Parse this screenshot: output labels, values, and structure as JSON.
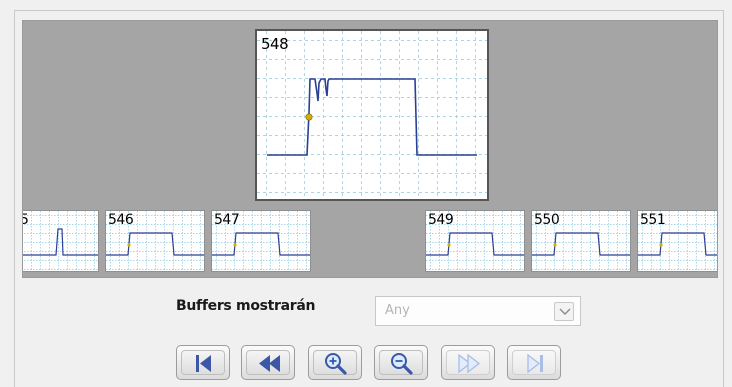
{
  "filmstrip": {
    "selected": "548",
    "thumbnails": [
      {
        "label": "5"
      },
      {
        "label": "546"
      },
      {
        "label": "547"
      },
      {
        "label": "548"
      },
      {
        "label": "549"
      },
      {
        "label": "550"
      },
      {
        "label": "551"
      }
    ]
  },
  "controls": {
    "buffers_label": "Buffers mostrarán",
    "buffers_value": "Any"
  },
  "nav_buttons": [
    {
      "icon": "skip-to-first-icon",
      "enabled": true
    },
    {
      "icon": "rewind-icon",
      "enabled": true
    },
    {
      "icon": "zoom-in-icon",
      "enabled": true
    },
    {
      "icon": "zoom-out-icon",
      "enabled": true
    },
    {
      "icon": "fast-forward-icon",
      "enabled": false
    },
    {
      "icon": "skip-to-last-icon",
      "enabled": false
    }
  ],
  "colors": {
    "waveform": "#2b3f94",
    "grid": "#8ec7de",
    "cursor": "#d4b000",
    "enabled_icon": "#3b57a6",
    "disabled_icon": "#a9bde6"
  }
}
